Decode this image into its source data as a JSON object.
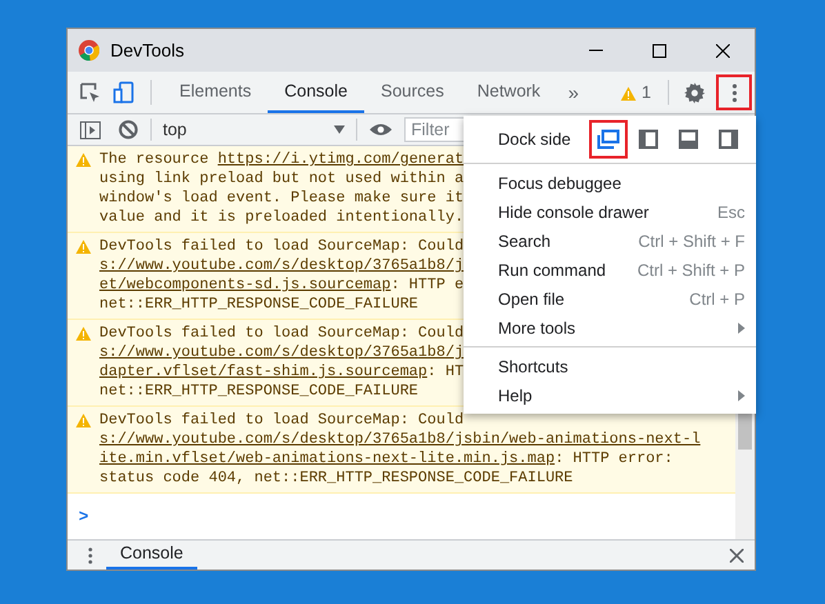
{
  "window": {
    "title": "DevTools"
  },
  "tabs": [
    {
      "label": "Elements",
      "selected": false
    },
    {
      "label": "Console",
      "selected": true
    },
    {
      "label": "Sources",
      "selected": false
    },
    {
      "label": "Network",
      "selected": false
    }
  ],
  "overflow_tabs": "»",
  "warnings": {
    "count": "1"
  },
  "more_button": {
    "highlighted": true
  },
  "console_toolbar": {
    "context": "top",
    "filter": {
      "placeholder": "Filter"
    }
  },
  "messages": [
    {
      "lines": [
        [
          {
            "text": "The resource ",
            "link": false
          },
          {
            "text": "https://i.ytimg.com/generat",
            "link": true
          }
        ],
        [
          {
            "text": "using link preload but not used within a",
            "link": false
          }
        ],
        [
          {
            "text": "window's load event. Please make sure it",
            "link": false
          }
        ],
        [
          {
            "text": "value and it is preloaded intentionally.",
            "link": false
          }
        ]
      ]
    },
    {
      "lines": [
        [
          {
            "text": "DevTools failed to load SourceMap: Could",
            "link": false
          }
        ],
        [
          {
            "text": "s://www.youtube.com/s/desktop/3765a1b8/j",
            "link": true
          }
        ],
        [
          {
            "text": "et/webcomponents-sd.js.sourcemap",
            "link": true
          },
          {
            "text": ": HTTP e",
            "link": false
          }
        ],
        [
          {
            "text": "net::ERR_HTTP_RESPONSE_CODE_FAILURE",
            "link": false
          }
        ]
      ]
    },
    {
      "lines": [
        [
          {
            "text": "DevTools failed to load SourceMap: Could",
            "link": false
          }
        ],
        [
          {
            "text": "s://www.youtube.com/s/desktop/3765a1b8/j",
            "link": true
          }
        ],
        [
          {
            "text": "dapter.vflset/fast-shim.js.sourcemap",
            "link": true
          },
          {
            "text": ": HT",
            "link": false
          }
        ],
        [
          {
            "text": "net::ERR_HTTP_RESPONSE_CODE_FAILURE",
            "link": false
          }
        ]
      ]
    },
    {
      "lines": [
        [
          {
            "text": "DevTools failed to load SourceMap: Could",
            "link": false
          }
        ],
        [
          {
            "text": "s://www.youtube.com/s/desktop/3765a1b8/jsbin/web-animations-next-l",
            "link": true
          }
        ],
        [
          {
            "text": "ite.min.vflset/web-animations-next-lite.min.js.map",
            "link": true
          },
          {
            "text": ": HTTP error:",
            "link": false
          }
        ],
        [
          {
            "text": "status code 404, net::ERR_HTTP_RESPONSE_CODE_FAILURE",
            "link": false
          }
        ]
      ]
    }
  ],
  "prompt": ">",
  "menu": {
    "dock_side": {
      "label": "Dock side",
      "options": [
        {
          "kind": "undock",
          "selected": true,
          "highlighted": true
        },
        {
          "kind": "left",
          "selected": false,
          "highlighted": false
        },
        {
          "kind": "bottom",
          "selected": false,
          "highlighted": false
        },
        {
          "kind": "right",
          "selected": false,
          "highlighted": false
        }
      ]
    },
    "sections": [
      [
        {
          "label": "Focus debuggee",
          "has_submenu": false
        },
        {
          "label": "Hide console drawer",
          "shortcut": "Esc",
          "has_submenu": false
        },
        {
          "label": "Search",
          "shortcut": "Ctrl + Shift + F",
          "has_submenu": false
        },
        {
          "label": "Run command",
          "shortcut": "Ctrl + Shift + P",
          "has_submenu": false
        },
        {
          "label": "Open file",
          "shortcut": "Ctrl + P",
          "has_submenu": false
        },
        {
          "label": "More tools",
          "has_submenu": true
        }
      ],
      [
        {
          "label": "Shortcuts",
          "has_submenu": false
        },
        {
          "label": "Help",
          "has_submenu": true
        }
      ]
    ]
  },
  "drawer": {
    "tabs": [
      {
        "label": "Console",
        "selected": true
      }
    ]
  }
}
